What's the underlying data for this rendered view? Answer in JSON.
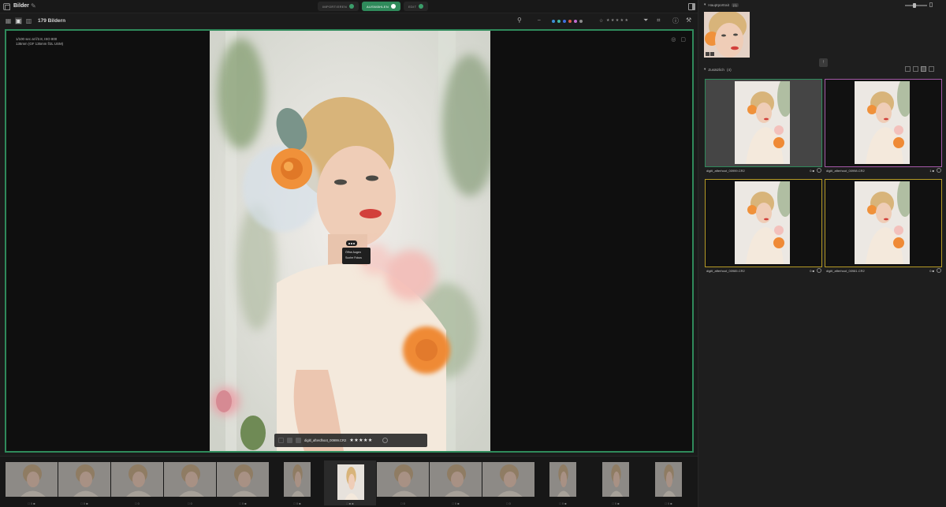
{
  "app": {
    "title": "Bilder",
    "icon": "window-icon",
    "edit_icon": "pencil-icon"
  },
  "workflow": {
    "steps": [
      {
        "label": "IMPORTIEREN",
        "state": "done"
      },
      {
        "label": "AUSWÄHLEN",
        "state": "active"
      },
      {
        "label": "EDIT",
        "state": "pending"
      }
    ]
  },
  "toolbar": {
    "image_count": "179 Bildern",
    "color_labels": [
      "#3d8fd8",
      "#41b6a5",
      "#3f6ee0",
      "#d85a4a",
      "#c46bd2",
      "#8c8c8c"
    ],
    "star_filter": "★ ★ ★ ★ ★",
    "icons": [
      "zoom-icon",
      "compare-icon",
      "color-filter-icon",
      "star-filter-icon",
      "funnel-icon",
      "crop-icon",
      "info-icon",
      "wand-icon"
    ]
  },
  "viewer": {
    "exif_line1": "1/100 sec at f/2.8, ISO 800",
    "exif_line2": "135mm (GF 135mm f/2L USM)",
    "menu_items": [
      "Öffne Augen",
      "Suche Fokus"
    ],
    "caption_name": "digitl_afterdhoot_00999.CR2",
    "caption_stars": "★★★★★"
  },
  "filmstrip": {
    "items": [
      {
        "meta": "□ 0 ■",
        "type": "landscape"
      },
      {
        "meta": "□ 0 ■",
        "type": "landscape"
      },
      {
        "meta": "□ 0",
        "type": "landscape"
      },
      {
        "meta": "□ 0",
        "type": "landscape"
      },
      {
        "meta": "□ 0 ■",
        "type": "landscape"
      },
      {
        "meta": "□ 0 ■",
        "type": "portrait"
      },
      {
        "meta": "□ ■ ■",
        "type": "selected"
      },
      {
        "meta": "□ 0",
        "type": "landscape"
      },
      {
        "meta": "□ 0 ■",
        "type": "landscape"
      },
      {
        "meta": "□ 0",
        "type": "landscape"
      },
      {
        "meta": "□ 0 ■",
        "type": "portrait"
      },
      {
        "meta": "□ 0 ■",
        "type": "portrait"
      },
      {
        "meta": "□ 0 ■",
        "type": "portrait"
      }
    ]
  },
  "rightpanel": {
    "main_header": "Hauptportrait",
    "main_count": "(1)",
    "candidates_header": "Zusätzlich",
    "candidates_count": "(4)",
    "collapse_label": "↑",
    "candidates": [
      {
        "name": "digitl_afterhoot_00999.CR2",
        "rating": "0 ■",
        "border": "#2f8a5b"
      },
      {
        "name": "digitl_afterhoot_00998.CR2",
        "rating": "1 ■",
        "border": "#a55aa8"
      },
      {
        "name": "digitl_afterhoot_00985.CR2",
        "rating": "0 ■",
        "border": "#b59a26"
      },
      {
        "name": "digitl_afterhoot_00981.CR2",
        "rating": "0 ■",
        "border": "#b59a26"
      }
    ]
  }
}
